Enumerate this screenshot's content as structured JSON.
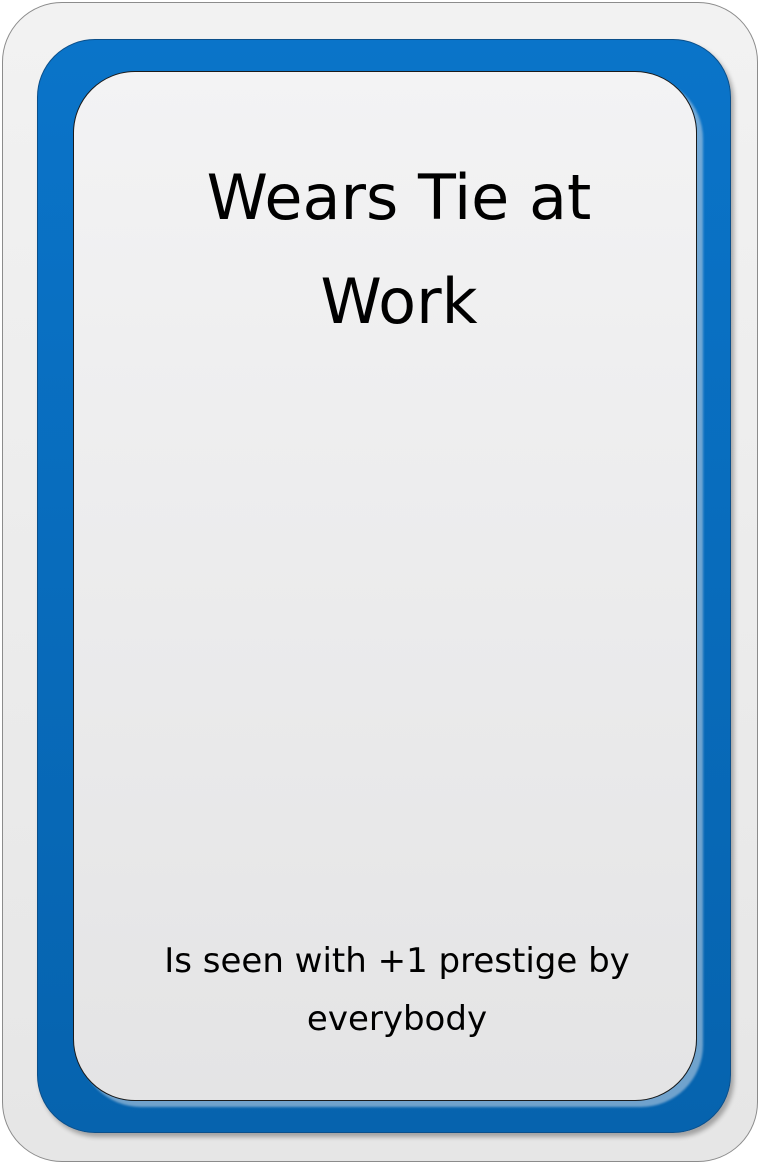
{
  "card": {
    "title_lines": [
      "Wears Tie at",
      "Work"
    ],
    "description_lines": [
      "Is seen with +1 prestige by",
      "everybody"
    ]
  },
  "colors": {
    "frame_blue": "#0a74c9",
    "panel_gray": "#ececec",
    "text": "#000000"
  }
}
